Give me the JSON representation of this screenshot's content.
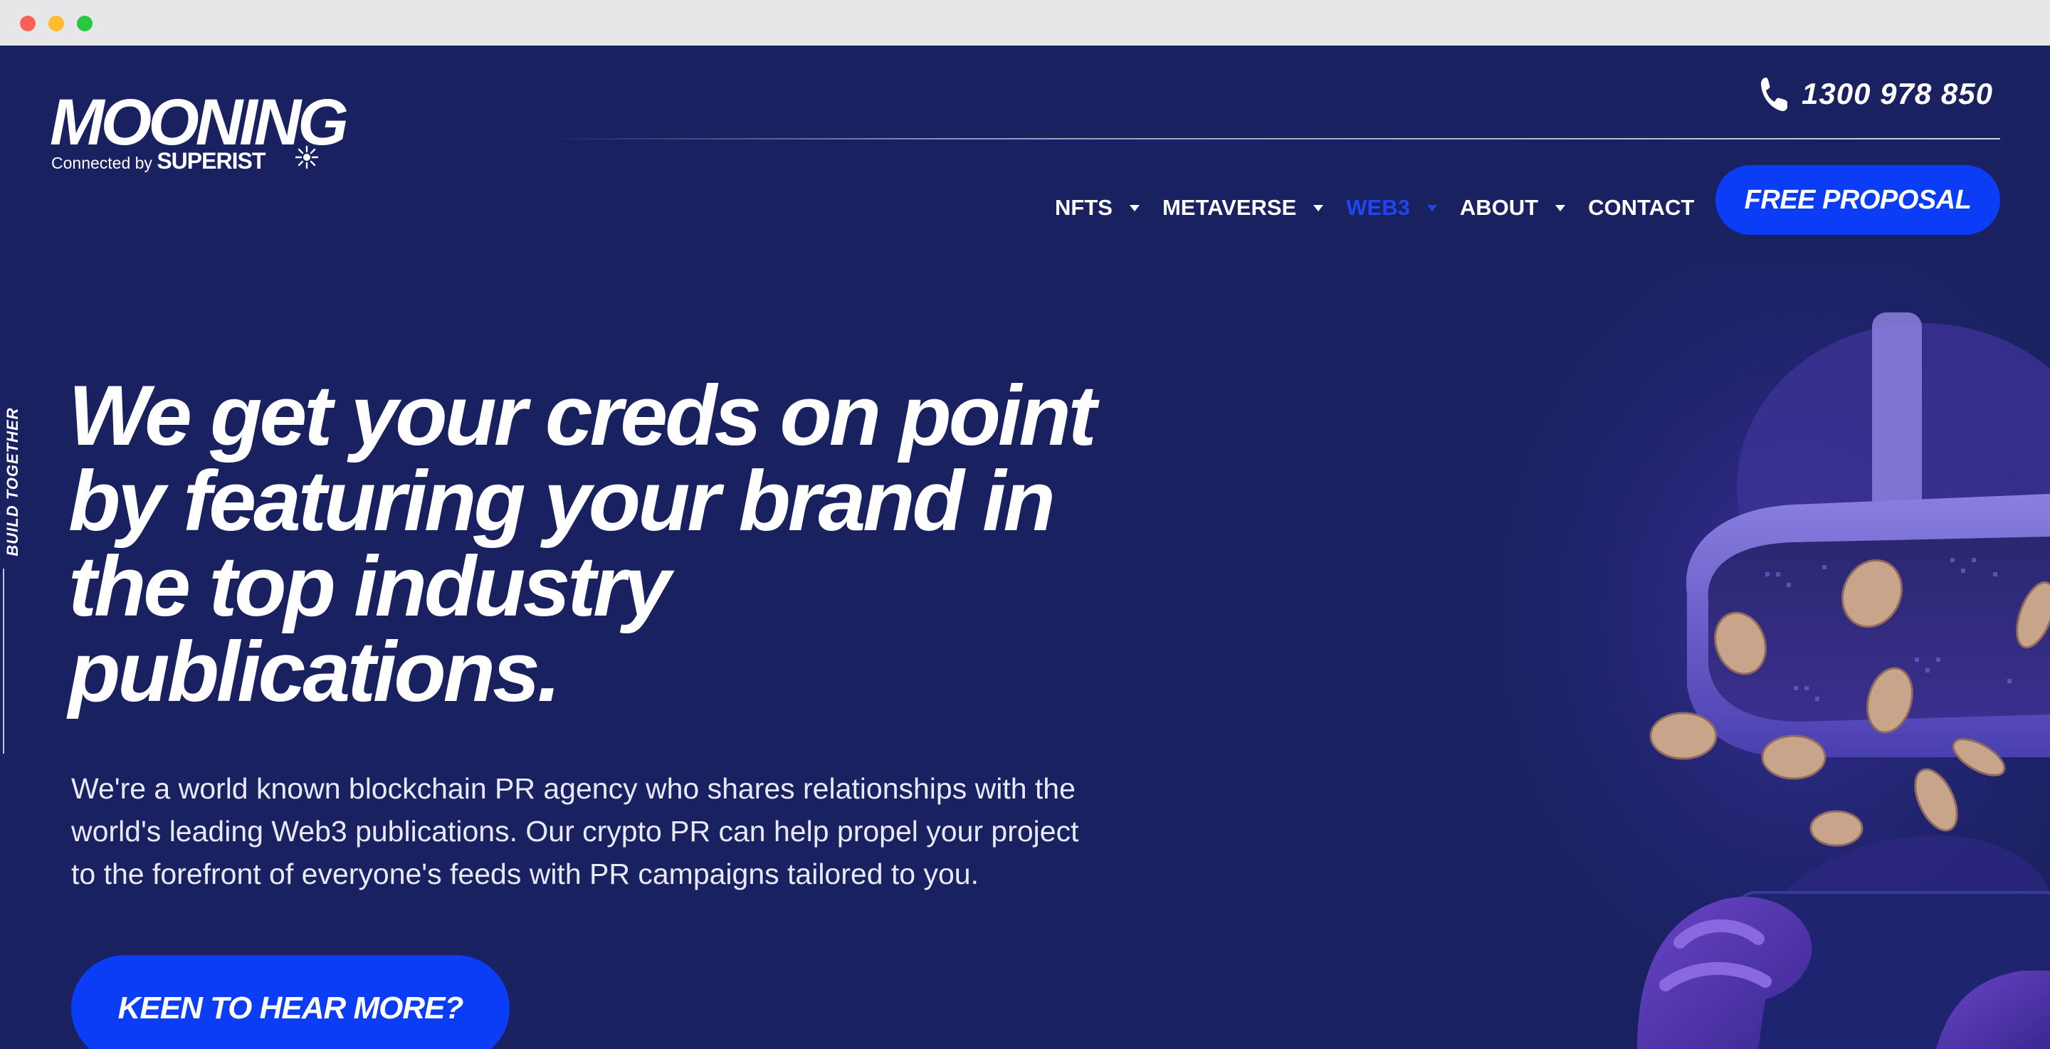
{
  "brand": {
    "name": "MOONING",
    "tagline_prefix": "Connected by",
    "tagline_brand": "SUPERIST"
  },
  "header": {
    "phone": "1300 978 850"
  },
  "nav": {
    "items": [
      {
        "label": "NFTS",
        "has_dropdown": true
      },
      {
        "label": "METAVERSE",
        "has_dropdown": true
      },
      {
        "label": "WEB3",
        "has_dropdown": true,
        "active": true
      },
      {
        "label": "ABOUT",
        "has_dropdown": true
      },
      {
        "label": "CONTACT",
        "has_dropdown": false
      }
    ],
    "cta_label": "FREE PROPOSAL"
  },
  "side": {
    "label": "BUILD TOGETHER"
  },
  "hero": {
    "title_lines": [
      "We get your creds on point",
      "by featuring your brand in",
      "the top industry",
      "publications."
    ],
    "subtitle_lines": [
      "We're a world known blockchain PR agency who shares relationships with the",
      "world's leading Web3 publications. Our crypto PR can help propel your project",
      "to the forefront of everyone's feeds with PR campaigns tailored to you."
    ],
    "cta_label": "KEEN TO HEAR MORE?"
  },
  "colors": {
    "background": "#1a2160",
    "accent": "#0a3df5",
    "active_nav": "#1f47f0",
    "text": "#ffffff"
  },
  "icons": {
    "phone": "phone-icon",
    "caret": "caret-down-icon",
    "star": "sunburst-icon"
  }
}
